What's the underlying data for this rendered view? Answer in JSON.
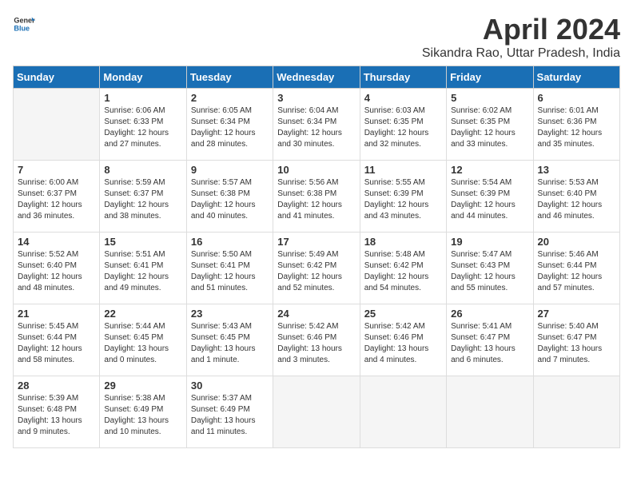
{
  "logo": {
    "general": "General",
    "blue": "Blue"
  },
  "title": "April 2024",
  "subtitle": "Sikandra Rao, Uttar Pradesh, India",
  "weekdays": [
    "Sunday",
    "Monday",
    "Tuesday",
    "Wednesday",
    "Thursday",
    "Friday",
    "Saturday"
  ],
  "weeks": [
    [
      {
        "day": "",
        "empty": true
      },
      {
        "day": "1",
        "sunrise": "6:06 AM",
        "sunset": "6:33 PM",
        "daylight": "12 hours and 27 minutes."
      },
      {
        "day": "2",
        "sunrise": "6:05 AM",
        "sunset": "6:34 PM",
        "daylight": "12 hours and 28 minutes."
      },
      {
        "day": "3",
        "sunrise": "6:04 AM",
        "sunset": "6:34 PM",
        "daylight": "12 hours and 30 minutes."
      },
      {
        "day": "4",
        "sunrise": "6:03 AM",
        "sunset": "6:35 PM",
        "daylight": "12 hours and 32 minutes."
      },
      {
        "day": "5",
        "sunrise": "6:02 AM",
        "sunset": "6:35 PM",
        "daylight": "12 hours and 33 minutes."
      },
      {
        "day": "6",
        "sunrise": "6:01 AM",
        "sunset": "6:36 PM",
        "daylight": "12 hours and 35 minutes."
      }
    ],
    [
      {
        "day": "7",
        "sunrise": "6:00 AM",
        "sunset": "6:37 PM",
        "daylight": "12 hours and 36 minutes."
      },
      {
        "day": "8",
        "sunrise": "5:59 AM",
        "sunset": "6:37 PM",
        "daylight": "12 hours and 38 minutes."
      },
      {
        "day": "9",
        "sunrise": "5:57 AM",
        "sunset": "6:38 PM",
        "daylight": "12 hours and 40 minutes."
      },
      {
        "day": "10",
        "sunrise": "5:56 AM",
        "sunset": "6:38 PM",
        "daylight": "12 hours and 41 minutes."
      },
      {
        "day": "11",
        "sunrise": "5:55 AM",
        "sunset": "6:39 PM",
        "daylight": "12 hours and 43 minutes."
      },
      {
        "day": "12",
        "sunrise": "5:54 AM",
        "sunset": "6:39 PM",
        "daylight": "12 hours and 44 minutes."
      },
      {
        "day": "13",
        "sunrise": "5:53 AM",
        "sunset": "6:40 PM",
        "daylight": "12 hours and 46 minutes."
      }
    ],
    [
      {
        "day": "14",
        "sunrise": "5:52 AM",
        "sunset": "6:40 PM",
        "daylight": "12 hours and 48 minutes."
      },
      {
        "day": "15",
        "sunrise": "5:51 AM",
        "sunset": "6:41 PM",
        "daylight": "12 hours and 49 minutes."
      },
      {
        "day": "16",
        "sunrise": "5:50 AM",
        "sunset": "6:41 PM",
        "daylight": "12 hours and 51 minutes."
      },
      {
        "day": "17",
        "sunrise": "5:49 AM",
        "sunset": "6:42 PM",
        "daylight": "12 hours and 52 minutes."
      },
      {
        "day": "18",
        "sunrise": "5:48 AM",
        "sunset": "6:42 PM",
        "daylight": "12 hours and 54 minutes."
      },
      {
        "day": "19",
        "sunrise": "5:47 AM",
        "sunset": "6:43 PM",
        "daylight": "12 hours and 55 minutes."
      },
      {
        "day": "20",
        "sunrise": "5:46 AM",
        "sunset": "6:44 PM",
        "daylight": "12 hours and 57 minutes."
      }
    ],
    [
      {
        "day": "21",
        "sunrise": "5:45 AM",
        "sunset": "6:44 PM",
        "daylight": "12 hours and 58 minutes."
      },
      {
        "day": "22",
        "sunrise": "5:44 AM",
        "sunset": "6:45 PM",
        "daylight": "13 hours and 0 minutes."
      },
      {
        "day": "23",
        "sunrise": "5:43 AM",
        "sunset": "6:45 PM",
        "daylight": "13 hours and 1 minute."
      },
      {
        "day": "24",
        "sunrise": "5:42 AM",
        "sunset": "6:46 PM",
        "daylight": "13 hours and 3 minutes."
      },
      {
        "day": "25",
        "sunrise": "5:42 AM",
        "sunset": "6:46 PM",
        "daylight": "13 hours and 4 minutes."
      },
      {
        "day": "26",
        "sunrise": "5:41 AM",
        "sunset": "6:47 PM",
        "daylight": "13 hours and 6 minutes."
      },
      {
        "day": "27",
        "sunrise": "5:40 AM",
        "sunset": "6:47 PM",
        "daylight": "13 hours and 7 minutes."
      }
    ],
    [
      {
        "day": "28",
        "sunrise": "5:39 AM",
        "sunset": "6:48 PM",
        "daylight": "13 hours and 9 minutes."
      },
      {
        "day": "29",
        "sunrise": "5:38 AM",
        "sunset": "6:49 PM",
        "daylight": "13 hours and 10 minutes."
      },
      {
        "day": "30",
        "sunrise": "5:37 AM",
        "sunset": "6:49 PM",
        "daylight": "13 hours and 11 minutes."
      },
      {
        "day": "",
        "empty": true
      },
      {
        "day": "",
        "empty": true
      },
      {
        "day": "",
        "empty": true
      },
      {
        "day": "",
        "empty": true
      }
    ]
  ]
}
